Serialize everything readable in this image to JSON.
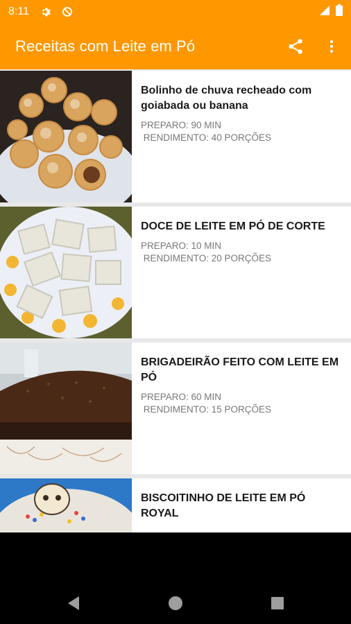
{
  "status": {
    "time": "8:11"
  },
  "app": {
    "title": "Receitas com Leite em Pó"
  },
  "icons": {
    "settings": "gear-icon",
    "sync": "sync-off-icon",
    "signal": "signal-icon",
    "battery": "battery-icon",
    "share": "share-icon",
    "more": "more-vert-icon",
    "back": "back-icon",
    "home": "home-icon",
    "recents": "recents-icon"
  },
  "colors": {
    "primary": "#FF9800",
    "background": "#e8e8e8"
  },
  "recipes": [
    {
      "title": "Bolinho de chuva recheado com goiabada ou banana",
      "meta": "PREPARO: 90 MIN\n RENDIMENTO: 40 PORÇÕES"
    },
    {
      "title": "DOCE DE LEITE EM PÓ DE CORTE",
      "meta": "PREPARO: 10 MIN\n RENDIMENTO: 20 PORÇÕES"
    },
    {
      "title": "BRIGADEIRÃO FEITO COM LEITE EM PÓ",
      "meta": "PREPARO: 60 MIN\n RENDIMENTO: 15 PORÇÕES"
    },
    {
      "title": "BISCOITINHO DE LEITE EM PÓ ROYAL",
      "meta": ""
    }
  ]
}
